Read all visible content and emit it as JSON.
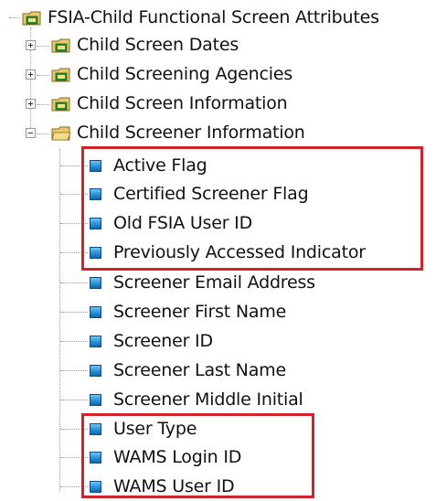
{
  "tree": {
    "root": {
      "label": "FSIA-Child Functional Screen Attributes",
      "icon": "folder-icon"
    },
    "collapsed_nodes": [
      {
        "label": "Child Screen Dates",
        "icon": "folder-icon"
      },
      {
        "label": "Child Screening Agencies",
        "icon": "folder-icon"
      },
      {
        "label": "Child Screen Information",
        "icon": "folder-icon"
      }
    ],
    "expanded_node": {
      "label": "Child Screener Information",
      "icon": "folder-icon",
      "children": [
        "Active Flag",
        "Certified Screener Flag",
        "Old FSIA User ID",
        "Previously Accessed Indicator",
        "Screener Email Address",
        "Screener First Name",
        "Screener ID",
        "Screener Last Name",
        "Screener Middle Initial",
        "User Type",
        "WAMS Login ID",
        "WAMS User ID"
      ]
    }
  },
  "colors": {
    "highlight_box": "#d2232a",
    "leaf_icon": "#2a8fd4",
    "folder_icon": "#d9b85a"
  }
}
